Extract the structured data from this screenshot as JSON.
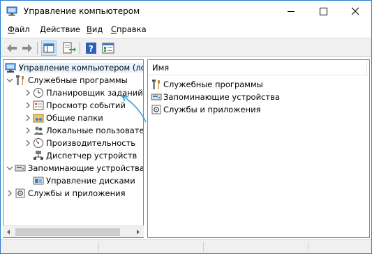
{
  "window": {
    "title": "Управление компьютером",
    "controls": {
      "minimize": "minimize",
      "maximize": "maximize",
      "close": "close"
    }
  },
  "menu": {
    "file": {
      "u": "Ф",
      "rest": "айл"
    },
    "action": {
      "u": "Д",
      "rest": "ействие"
    },
    "view": {
      "u": "В",
      "rest": "ид"
    },
    "help": {
      "u": "С",
      "rest": "правка"
    }
  },
  "toolbar": {
    "buttons": [
      "back-icon",
      "forward-icon",
      "console-tree-icon",
      "export-icon",
      "help-icon",
      "properties-icon"
    ]
  },
  "tree": {
    "root": "Управление компьютером (локальным)",
    "system_tools": "Служебные программы",
    "task_scheduler": "Планировщик заданий",
    "event_viewer": "Просмотр событий",
    "shared_folders": "Общие папки",
    "local_users": "Локальные пользователи",
    "performance": "Производительность",
    "device_manager": "Диспетчер устройств",
    "storage": "Запоминающие устройства",
    "disk_management": "Управление дисками",
    "services_apps": "Службы и приложения"
  },
  "list": {
    "column_name": "Имя",
    "items": [
      "Служебные программы",
      "Запоминающие устройства",
      "Службы и приложения"
    ]
  },
  "colors": {
    "window_border": "#2b7ad1",
    "annotation_arrow": "#3a9bd5",
    "selection": "#e5f3ff"
  }
}
